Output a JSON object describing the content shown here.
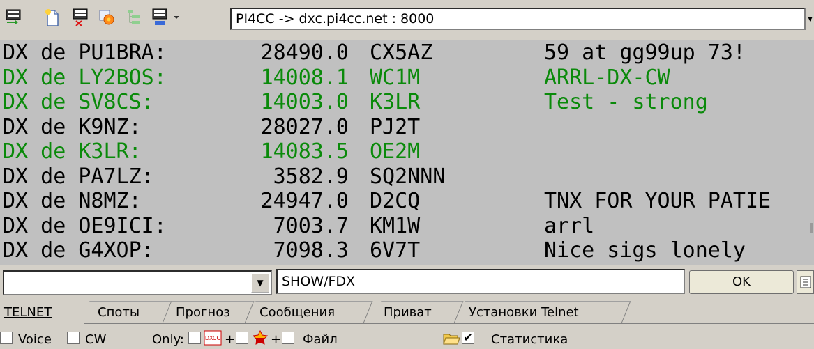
{
  "toolbar": {
    "icons": [
      "telnet-connect-icon",
      "new-document-icon",
      "telnet-disconnect-icon",
      "settings-icon",
      "tree-view-icon",
      "telnet-options-icon",
      "dropdown-arrow-icon"
    ],
    "address": "PI4CC -> dxc.pi4cc.net : 8000",
    "address_dropdown_glyph": "▾"
  },
  "terminal": {
    "colors": {
      "normal": "#000000",
      "highlight": "#0a8a0a",
      "background": "#c0c0c0"
    },
    "spots": [
      {
        "spotter": "DX de PU1BRA:",
        "freq": "28490.0",
        "dx": "CX5AZ",
        "comment": "59 at gg99up 73!",
        "color": "normal"
      },
      {
        "spotter": "DX de LY2BOS:",
        "freq": "14008.1",
        "dx": "WC1M",
        "comment": "ARRL-DX-CW",
        "color": "highlight"
      },
      {
        "spotter": "DX de SV8CS:",
        "freq": "14003.0",
        "dx": "K3LR",
        "comment": "Test - strong",
        "color": "highlight"
      },
      {
        "spotter": "DX de K9NZ:",
        "freq": "28027.0",
        "dx": "PJ2T",
        "comment": "",
        "color": "normal"
      },
      {
        "spotter": "DX de K3LR:",
        "freq": "14083.5",
        "dx": "OE2M",
        "comment": "",
        "color": "highlight"
      },
      {
        "spotter": "DX de PA7LZ:",
        "freq": "3582.9",
        "dx": "SQ2NNN",
        "comment": "",
        "color": "normal"
      },
      {
        "spotter": "DX de N8MZ:",
        "freq": "24947.0",
        "dx": "D2CQ",
        "comment": "TNX FOR YOUR PATIE",
        "color": "normal"
      },
      {
        "spotter": "DX de OE9ICI:",
        "freq": "7003.7",
        "dx": "KM1W",
        "comment": "arrl",
        "color": "normal"
      },
      {
        "spotter": "DX de G4XOP:",
        "freq": "7098.3",
        "dx": "6V7T",
        "comment": "Nice sigs lonely",
        "color": "normal"
      }
    ]
  },
  "command": {
    "combo_value": "",
    "combo_arrow": "▼",
    "input_value": "SHOW/FDX",
    "ok_label": "OK"
  },
  "tabs": [
    "TELNET",
    "Споты",
    "Прогноз",
    "Сообщения",
    "Приват",
    "Установки Telnet"
  ],
  "status": {
    "voice_label": "Voice",
    "cw_label": "CW",
    "only_label": "Only:",
    "plus1": "+",
    "plus2": "+",
    "file_label": "Файл",
    "stats_label": "Статистика",
    "stats_checked": "✔"
  }
}
